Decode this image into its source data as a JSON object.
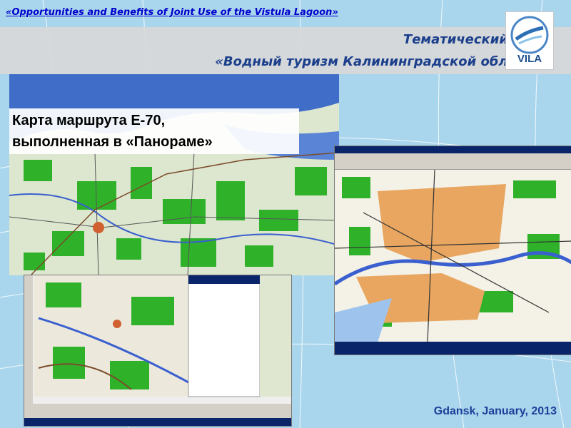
{
  "project_title": "«Opportunities and Benefits of Joint Use of the Vistula Lagoon»",
  "heading": {
    "line1": "Тематический",
    "line2": "«Водный туризм Калининградской области»."
  },
  "logo": {
    "text": "VILA"
  },
  "map_caption": {
    "line1": "Карта маршрута Е-70,",
    "line2": "выполненная в «Панораме»"
  },
  "footer": "Gdansk, January, 2013",
  "colors": {
    "background": "#a9d6ec",
    "title_blue": "#0000cc",
    "heading_blue": "#1c3f8c",
    "footer_blue": "#1d3f99",
    "forest_green": "#2fb22a",
    "water_blue": "#3b66c8",
    "urban_orange": "#e8a660"
  }
}
